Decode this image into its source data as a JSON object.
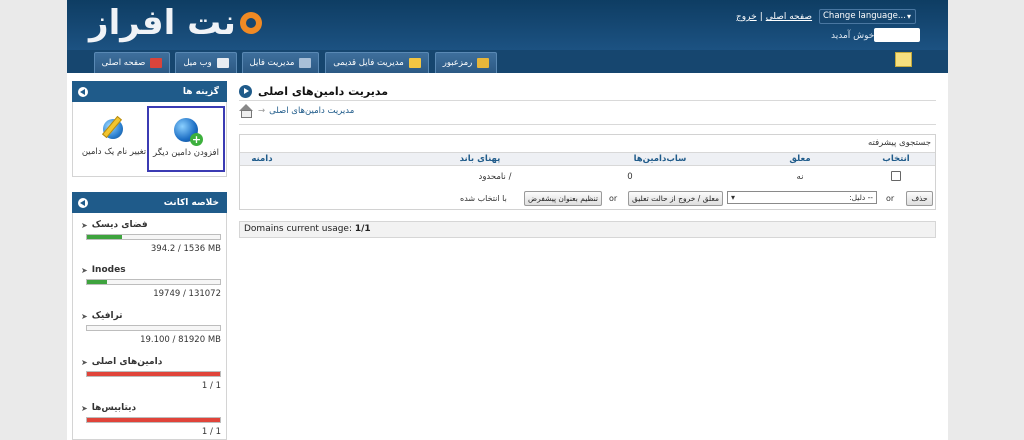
{
  "header": {
    "logo_text": "نت افراز",
    "top_links": {
      "home": "صفحه اصلی",
      "separator": "|",
      "logout": "خروج"
    },
    "language_select": "Change language...",
    "welcome": "خوش آمدید"
  },
  "nav": {
    "tabs": [
      {
        "label": "صفحه اصلی",
        "icon": "home-icon"
      },
      {
        "label": "وب میل",
        "icon": "mail-icon"
      },
      {
        "label": "مدیریت فایل",
        "icon": "files-icon"
      },
      {
        "label": "مدیریت فایل قدیمی",
        "icon": "folder-icon"
      },
      {
        "label": "رمزعبور",
        "icon": "key-icon"
      }
    ],
    "mail_icon": "envelope-icon"
  },
  "sidebar": {
    "options_title": "گزینه ها",
    "options": [
      {
        "label": "افزودن دامین دیگر",
        "icon": "globe-add-icon",
        "selected": true
      },
      {
        "label": "تغییر نام یک دامین",
        "icon": "globe-edit-icon",
        "selected": false
      }
    ],
    "account_title": "خلاصه اکانت",
    "stats": [
      {
        "title": "فضای دیسک",
        "value": "394.2 / 1536 MB",
        "fill_fraction": 0.26,
        "color": "#3ea33e"
      },
      {
        "title": "Inodes",
        "value": "19749 / 131072",
        "fill_fraction": 0.15,
        "color": "#3ea33e"
      },
      {
        "title": "ترافیک",
        "value": "19.100 / 81920 MB",
        "fill_fraction": 0.0,
        "color": "#3ea33e"
      },
      {
        "title": "دامین‌های اصلی",
        "value": "1 / 1",
        "fill_fraction": 1.0,
        "color": "#e0443a"
      },
      {
        "title": "دیتابیس‌ها",
        "value": "1 / 1",
        "fill_fraction": 1.0,
        "color": "#e0443a"
      }
    ]
  },
  "main": {
    "title": "مدیریت دامین‌های اصلی",
    "breadcrumb": "مدیریت دامین‌های اصلی",
    "advanced_search": "جستجوی پیشرفته",
    "columns": {
      "select": "انتخاب",
      "suspended": "معلق",
      "subdomains": "ساب‌دامین‌ها",
      "bandwidth": "پهنای باند",
      "domain": "دامنه"
    },
    "row": {
      "suspended": "نه",
      "subdomains": "0",
      "bandwidth": "نامحدود /",
      "domain": ""
    },
    "actions": {
      "delete": "حذف",
      "or1": "or",
      "reason_select": "-- دلیل:",
      "suspend": "معلق / خروج از حالت تعلیق",
      "or2": "or",
      "set_default": "تنظیم بعنوان پیشفرض",
      "selected_text": "با انتخاب شده"
    },
    "usage_label": "Domains current usage:",
    "usage_value": "1/1"
  }
}
